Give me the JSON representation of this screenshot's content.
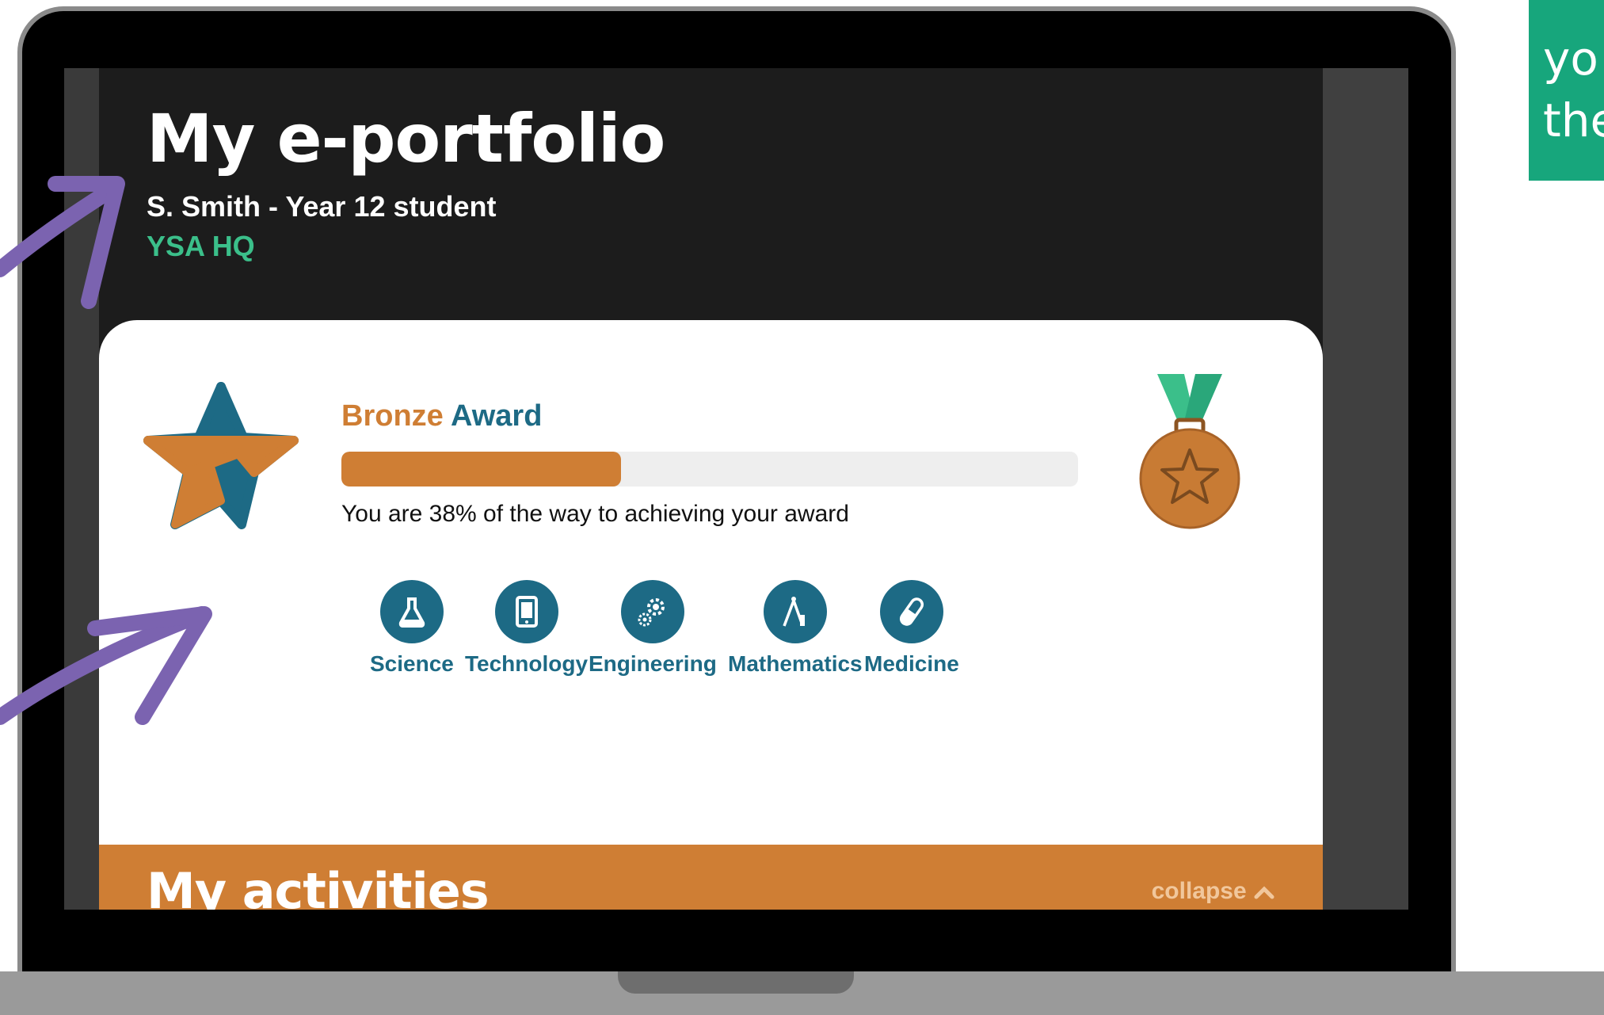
{
  "portfolio": {
    "title": "My e-portfolio",
    "student": "S. Smith - Year 12 student",
    "organisation": "YSA HQ"
  },
  "award": {
    "level": "Bronze",
    "word": "Award",
    "progress_percent": 38,
    "progress_text": "You are 38% of the way to achieving your award",
    "colors": {
      "bronze": "#cf7e34",
      "teal": "#1d6a85",
      "green": "#3bbf8a"
    }
  },
  "categories": [
    {
      "label": "Science",
      "icon": "flask-icon"
    },
    {
      "label": "Technology",
      "icon": "tablet-icon"
    },
    {
      "label": "Engineering",
      "icon": "gears-icon"
    },
    {
      "label": "Mathematics",
      "icon": "compass-icon"
    },
    {
      "label": "Medicine",
      "icon": "pill-icon"
    }
  ],
  "activities": {
    "title": "My activities",
    "collapse_label": "collapse"
  },
  "callout": {
    "line1": "yo",
    "line2": "the"
  }
}
